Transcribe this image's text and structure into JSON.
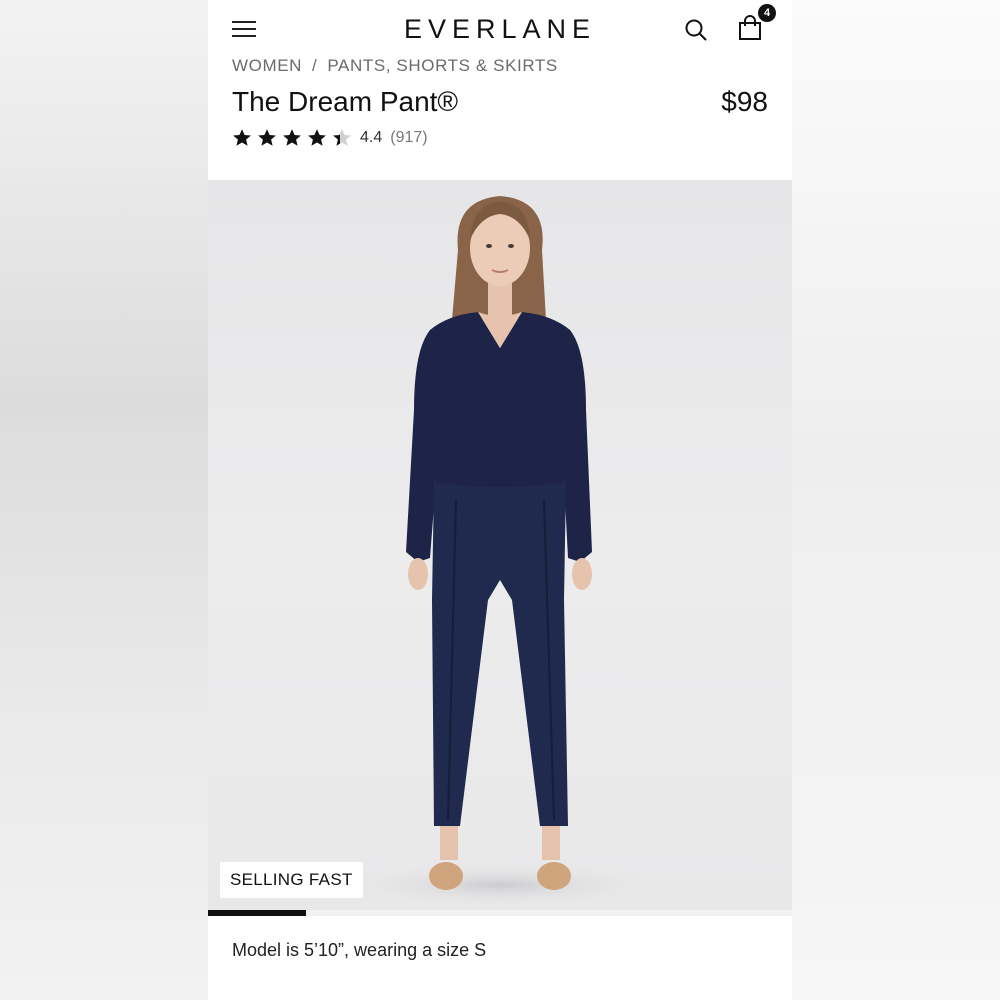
{
  "header": {
    "logo": "EVERLANE",
    "cart_count": "4"
  },
  "breadcrumb": [
    {
      "label": "WOMEN"
    },
    {
      "label": "PANTS, SHORTS & SKIRTS"
    }
  ],
  "breadcrumb_separator": "/",
  "product": {
    "title": "The Dream Pant®",
    "price": "$98",
    "rating": "4.4",
    "rating_value": 4.4,
    "rating_max": 5,
    "review_count": "(917)",
    "badge": "SELLING FAST",
    "model_note": "Model is 5’10”, wearing a size S"
  },
  "gallery": {
    "progress": 0.167
  },
  "colors": {
    "accent": "#111111",
    "muted_text": "#6b6b6b",
    "garment_navy": "#1f2a4e"
  },
  "icons": [
    "menu-icon",
    "search-icon",
    "shopping-bag-icon",
    "star-icon"
  ]
}
